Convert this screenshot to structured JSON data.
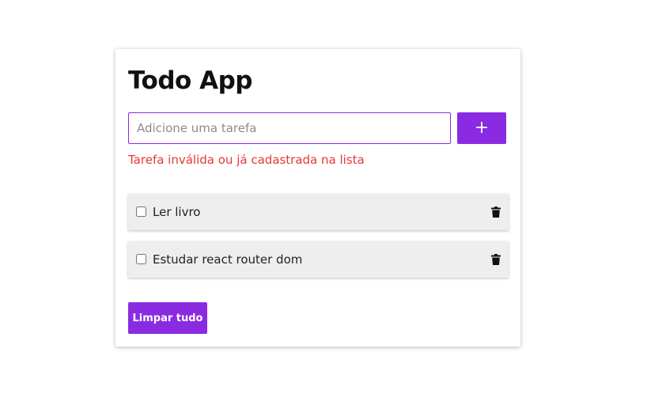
{
  "app": {
    "title": "Todo App"
  },
  "form": {
    "input_value": "",
    "input_placeholder": "Adicione uma tarefa",
    "add_label": "+",
    "error_message": "Tarefa inválida ou já cadastrada na lista"
  },
  "tasks": [
    {
      "label": "Ler livro",
      "checked": false
    },
    {
      "label": "Estudar react router dom",
      "checked": false
    }
  ],
  "actions": {
    "clear_label": "Limpar tudo"
  },
  "colors": {
    "accent": "#8a2be2",
    "error": "#e53935",
    "item_background": "#eeeeee"
  },
  "icons": {
    "delete": "trash-icon"
  }
}
